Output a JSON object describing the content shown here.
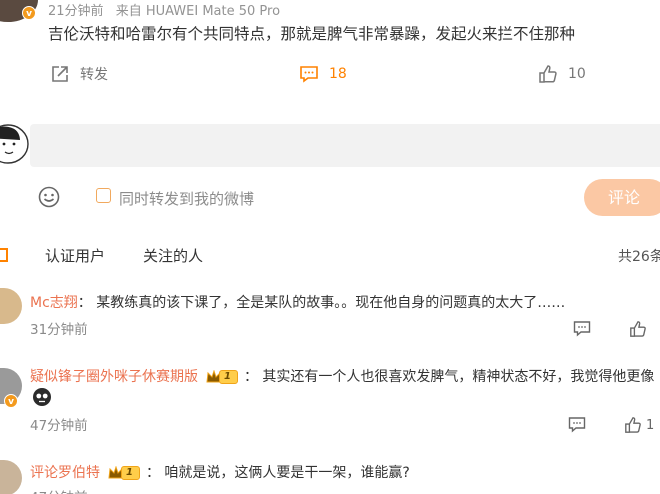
{
  "post": {
    "time": "21分钟前",
    "source": "来自 HUAWEI Mate 50 Pro",
    "text": "吉伦沃特和哈雷尔有个共同特点，那就是脾气非常暴躁，发起火来拦不住那种",
    "repost_label": "转发",
    "comment_count": "18",
    "like_count": "10",
    "badge_letter": "v"
  },
  "composer": {
    "placeholder": "",
    "repost_checkbox_label": "同时转发到我的微博",
    "submit_label": "评论"
  },
  "filter": {
    "tabs": [
      "认证用户",
      "关注的人"
    ],
    "total": "共26条"
  },
  "comments": [
    {
      "name": "Mc志翔",
      "text": "：  某教练真的该下课了，全是某队的故事。。现在他自身的问题真的太大了……",
      "time": "31分钟前",
      "like_count": ""
    },
    {
      "name": "疑似锋子圈外咪子休赛期版",
      "level": "1",
      "text": "：  其实还有一个人也很喜欢发脾气，精神状态不好，我觉得他更像",
      "emoji": "skull-emoji",
      "time": "47分钟前",
      "like_count": "1"
    },
    {
      "name": "评论罗伯特",
      "level": "1",
      "text": "：  咱就是说，这俩人要是干一架，谁能赢?",
      "time": "47分钟前"
    }
  ],
  "colors": {
    "accent": "#ff8200",
    "name": "#eb7350",
    "button_disabled": "#fbc8a4",
    "input_bg": "#f2f2f2"
  }
}
